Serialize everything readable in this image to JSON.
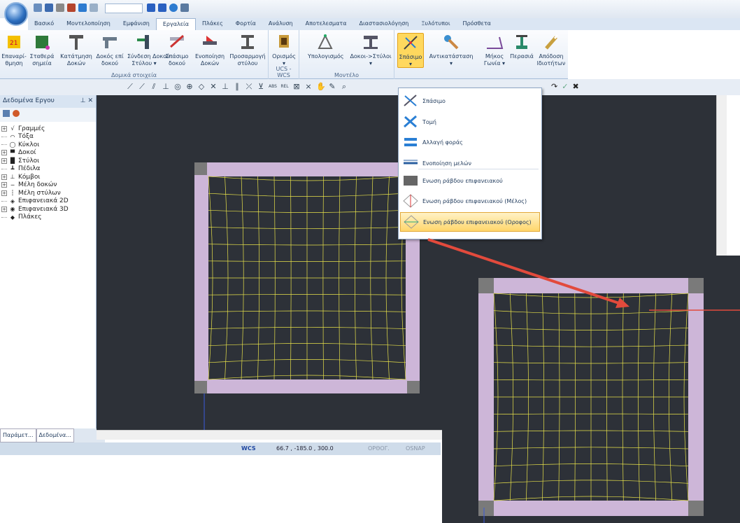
{
  "tabs": [
    "Βασικό",
    "Μοντελοποίηση",
    "Εμφάνιση",
    "Εργαλεία",
    "Πλάκες",
    "Φορτία",
    "Ανάλυση",
    "Αποτελεσματα",
    "Διαστασιολόγηση",
    "Ξυλότυποι",
    "Πρόσθετα"
  ],
  "active_tab": "Εργαλεία",
  "ribbon": {
    "structural": {
      "label": "Δομικά στοιχεία",
      "buttons": [
        {
          "name": "renumber",
          "label": "Επαναρί-\nθμηση"
        },
        {
          "name": "fixed-points",
          "label": "Σταθερά\nσημεία"
        },
        {
          "name": "beam-split",
          "label": "Κατάτμηση\nΔοκών"
        },
        {
          "name": "beam-on-beam",
          "label": "Δοκός επί\nδοκού"
        },
        {
          "name": "connect-beam-column",
          "label": "Σύνδεση Δοκού\nΣτύλου ▾"
        },
        {
          "name": "break-beam",
          "label": "Σπάσιμο\nδοκού"
        },
        {
          "name": "merge-beams",
          "label": "Ενοποίηση\nΔοκών"
        },
        {
          "name": "adjust-column",
          "label": "Προσαρμογή\nστύλου"
        }
      ]
    },
    "ucs": {
      "label": "UCS - WCS",
      "button": "Ορισμός\n▾"
    },
    "model": {
      "label": "Μοντέλο",
      "buttons": [
        "Υπολογισμός",
        "Δοκοι->Στύλοι\n▾"
      ]
    },
    "split": {
      "label": "Σπάσιμο\n▾"
    },
    "replace": {
      "label": "Αντικατάσταση\n▾"
    },
    "measure": {
      "buttons": [
        "Μήκος\nΓωνία ▾",
        "Περασιά",
        "Απόδοση\nΙδιοτήτων"
      ]
    }
  },
  "left_panel": {
    "title": "Δεδομένα Εργου",
    "pin": "⊥ ✕",
    "tree": [
      {
        "label": "Γραμμές",
        "exp": "+",
        "icon": "√"
      },
      {
        "label": "Τόξα",
        "exp": "",
        "icon": "◠"
      },
      {
        "label": "Κύκλοι",
        "exp": "",
        "icon": "◯"
      },
      {
        "label": "Δοκοί",
        "exp": "+",
        "icon": "▀"
      },
      {
        "label": "Στύλοι",
        "exp": "+",
        "icon": "█"
      },
      {
        "label": "Πέδιλα",
        "exp": "",
        "icon": "┻"
      },
      {
        "label": "Κόμβοι",
        "exp": "+",
        "icon": "⊥"
      },
      {
        "label": "Μέλη δοκών",
        "exp": "+",
        "icon": "─"
      },
      {
        "label": "Μέλη στύλων",
        "exp": "+",
        "icon": "┆"
      },
      {
        "label": "Επιφανειακά 2D",
        "exp": "",
        "icon": "◈"
      },
      {
        "label": "Επιφανειακά 3D",
        "exp": "+",
        "icon": "◉"
      },
      {
        "label": "Πλάκες",
        "exp": "",
        "icon": "◆"
      }
    ],
    "tabs": [
      "Παράμετ...",
      "Δεδομένα..."
    ]
  },
  "status": {
    "wcs": "WCS",
    "coords": "66.7 , -185.0 , 300.0",
    "ortho": "ΟΡΘΟΓ.",
    "osnap": "OSNAP"
  },
  "menu": {
    "items": [
      {
        "label": "Σπάσιμο",
        "icon": "split-icon"
      },
      {
        "label": "Τομή",
        "icon": "intersect-icon"
      },
      {
        "label": "Αλλαγή φοράς",
        "icon": "reverse-direction-icon"
      },
      {
        "label": "Ενοποίηση μελών",
        "icon": "merge-members-icon"
      },
      {
        "label": "Ενωση ράβδου επιφανειακού",
        "icon": "surface-link-icon"
      },
      {
        "label": "Ενωση ράβδου επιφανειακού (Μέλος)",
        "icon": "surface-link-member-icon"
      },
      {
        "label": "Ενωση ράβδου επιφανειακού (Οροφος)",
        "icon": "surface-link-floor-icon"
      }
    ],
    "highlighted": "Ενωση ράβδου επιφανειακού (Οροφος)"
  },
  "colors": {
    "canvas": "#2d3138",
    "slab_border": "#cdb6d8",
    "column": "#7a7a7a",
    "mesh": "#e8e24a",
    "highlight": "#ffd66b",
    "arrow": "#e24a3c"
  }
}
